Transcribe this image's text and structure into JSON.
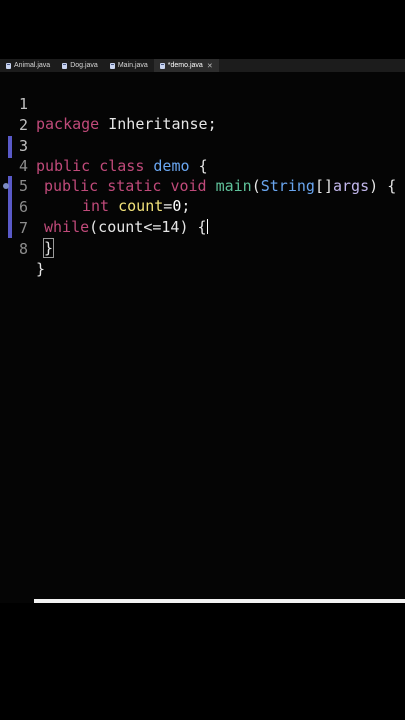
{
  "tabs": [
    {
      "label": "Animal.java",
      "active": false,
      "closable": false
    },
    {
      "label": "Dog.java",
      "active": false,
      "closable": false
    },
    {
      "label": "Main.java",
      "active": false,
      "closable": false
    },
    {
      "label": "*demo.java",
      "active": true,
      "closable": true
    }
  ],
  "tab_close_glyph": "✕",
  "editor": {
    "line_numbers": [
      "1",
      "2",
      "3",
      "4",
      "5",
      "6",
      "7",
      "8"
    ],
    "lines": {
      "l1": {
        "kw": "package",
        "name": "Inheritanse;"
      },
      "l3": {
        "kw1": "public",
        "kw2": "class",
        "name": "demo",
        "brace": "{"
      },
      "l4": {
        "kw1": "public",
        "kw2": "static",
        "kw3": "void",
        "fn": "main",
        "paren_open": "(",
        "type": "String",
        "brackets": "[]",
        "param": "args",
        "paren_close": ")",
        "brace": "{"
      },
      "l5": {
        "type": "int",
        "var": "count",
        "eq": "=",
        "num": "0",
        "semi": ";"
      },
      "l6": {
        "kw": "while",
        "cond": "(count<=14)",
        "brace": "{"
      },
      "l7": {
        "brace": "}"
      },
      "l8": {
        "brace": "}"
      }
    }
  },
  "colors": {
    "background": "#050505",
    "keyword": "#c04a7a",
    "method": "#5fc19a",
    "type": "#6aa6f0",
    "variable": "#f2e27a"
  }
}
